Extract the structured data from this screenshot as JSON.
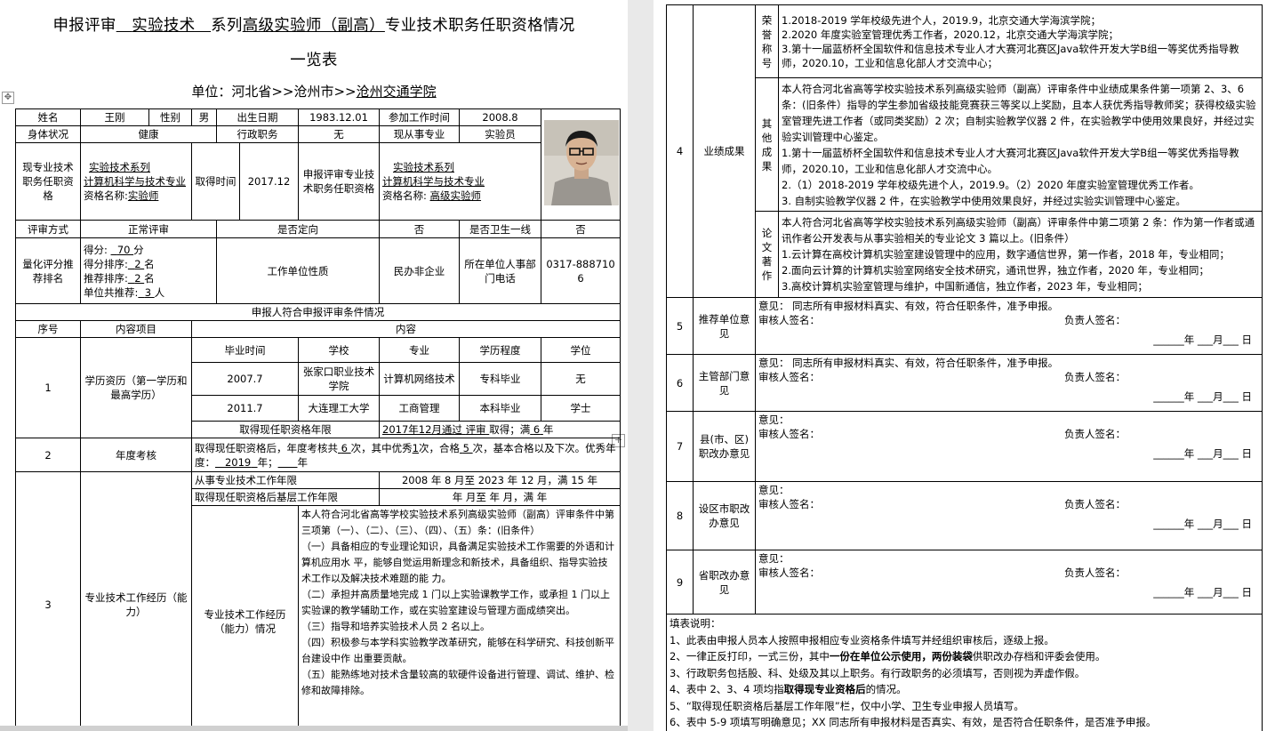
{
  "title": {
    "prefix": "申报评审",
    "series": "实验技术",
    "mid": "系列",
    "qualification": "高级实验师（副高）",
    "suffix": "专业技术职务任职资格情况",
    "line2": "一览表"
  },
  "unit": {
    "prefix": "单位：河北省>>沧州市>>",
    "name": "沧州交通学院"
  },
  "basic": {
    "name_label": "姓名",
    "name": "王刚",
    "gender_label": "性别",
    "gender": "男",
    "dob_label": "出生日期",
    "dob": "1983.12.01",
    "work_start_label": "参加工作时间",
    "work_start": "2008.8",
    "health_label": "身体状况",
    "health": "健康",
    "admin_label": "行政职务",
    "admin": "无",
    "current_major_label": "现从事专业",
    "current_major": "实验员",
    "current_qual_label": "现专业技术职务任职资格",
    "current_qual_series": "实验技术系列",
    "current_qual_major": "计算机科学与技术专业",
    "current_qual_name_label": "资格名称:",
    "current_qual_name": "实验师",
    "obtain_time_label": "取得时间",
    "obtain_time": "2017.12",
    "apply_qual_label": "申报评审专业技术职务任职资格",
    "apply_qual_series": "实验技术系列",
    "apply_qual_major": "计算机科学与技术专业",
    "apply_qual_name_label": "资格名称:",
    "apply_qual_name": "高级实验师",
    "review_method_label": "评审方式",
    "review_method": "正常评审",
    "directed_label": "是否定向",
    "directed": "否",
    "health_front_label": "是否卫生一线",
    "health_front": "否",
    "quant_label": "量化评分推荐排名",
    "score_label": "得分:",
    "score": "70",
    "score_unit": "分",
    "rank_label": "得分排序:",
    "rank": "2",
    "rank_unit": "名",
    "rec_rank_label": "推荐排序:",
    "rec_rank": "2",
    "rec_rank_unit": "名",
    "rec_total_label": "单位共推荐:",
    "rec_total": "3",
    "rec_total_unit": "人",
    "unit_nature_label": "工作单位性质",
    "unit_nature": "民办非企业",
    "unit_phone_label": "所在单位人事部门电话",
    "unit_phone": "0317-8887106"
  },
  "conditions_header": "申报人符合申报评审条件情况",
  "table_headers": {
    "seq": "序号",
    "item": "内容项目",
    "content": "内容"
  },
  "education": {
    "seq": "1",
    "item": "学历资历（第一学历和最高学历）",
    "cols": [
      "毕业时间",
      "学校",
      "专业",
      "学历程度",
      "学位"
    ],
    "rows": [
      [
        "2007.7",
        "张家口职业技术学院",
        "计算机网络技术",
        "专科毕业",
        "无"
      ],
      [
        "2011.7",
        "大连理工大学",
        "工商管理",
        "本科毕业",
        "学士"
      ]
    ],
    "years_label": "取得现任职资格年限",
    "years_value_a": "2017年12月通过",
    "years_value_b": "评审",
    "years_value_c": "取得；满",
    "years_value_d": "6",
    "years_value_e": "年"
  },
  "annual": {
    "seq": "2",
    "item": "年度考核",
    "text_a": "取得现任职资格后，年度考核共",
    "total": "6",
    "text_b": "次，其中优秀",
    "excellent": "1",
    "text_c": "次，合格",
    "pass": "5",
    "text_d": "次，基本合格以及下次。优秀年度：",
    "year": "2019",
    "text_e": "年；",
    "text_f": "年"
  },
  "experience": {
    "seq": "3",
    "item": "专业技术工作经历（能力）",
    "years_label": "从事专业技术工作年限",
    "years_value": "2008 年 8 月至 2023 年 12 月，满 15 年",
    "grassroots_label": "取得现任职资格后基层工作年限",
    "grassroots_value": "年  月至  年  月，满  年",
    "sub_label": "专业技术工作经历（能力）情况",
    "paragraphs": [
      "本人符合河北省高等学校实验技术系列高级实验师（副高）评审条件中第三项第（一）、（二）、（三）、（四）、（五）条：(旧条件）",
      "（一）具备相应的专业理论知识，具备满足实验技术工作需要的外语和计算机应用水 平，能够自觉运用新理念和新技术，具备组织、指导实验技术工作以及解决技术难题的能 力。",
      "（二）承担并高质量地完成 1 门以上实验课教学工作，或承担 1 门以上实验课的教学辅助工作，或在实验室建设与管理方面成绩突出。",
      "（三）指导和培养实验技术人员 2 名以上。",
      "（四）积极参与本学科实验教学改革研究，能够在科学研究、科技创新平台建设中作 出重要贡献。",
      "（五）能熟练地对技术含量较高的软硬件设备进行管理、调试、维护、检修和故障排除。"
    ]
  },
  "achievements": {
    "seq": "4",
    "item": "业绩成果",
    "honors_label": "荣誉称号",
    "honors": [
      "1.2018-2019 学年校级先进个人，2019.9，北京交通大学海滨学院；",
      "2.2020 年度实验室管理优秀工作者，2020.12，北京交通大学海滨学院；",
      "3.第十一届蓝桥杯全国软件和信息技术专业人才大赛河北赛区Java软件开发大学B组一等奖优秀指导教师，2020.10，工业和信息化部人才交流中心；"
    ],
    "other_label": "其他成果",
    "other": [
      "本人符合河北省高等学校实验技术系列高级实验师（副高）评审条件中业绩成果条件第一项第 2、3、6 条：(旧条件）指导的学生参加省级技能竞赛获三等奖以上奖励，且本人获优秀指导教师奖；获得校级实验室管理先进工作者（或同类奖励）2 次；自制实验教学仪器 2 件，在实验教学中使用效果良好，并经过实验实训管理中心鉴定。",
      "1.第十一届蓝桥杯全国软件和信息技术专业人才大赛河北赛区Java软件开发大学B组一等奖优秀指导教师，2020.10，工业和信息化部人才交流中心。",
      "2.（1）2018-2019 学年校级先进个人，2019.9。（2）2020 年度实验室管理优秀工作者。",
      "3. 自制实验教学仪器 2 件，在实验教学中使用效果良好，并经过实验实训管理中心鉴定。"
    ],
    "papers_label": "论文著作",
    "papers": [
      "本人符合河北省高等学校实验技术系列高级实验师（副高）评审条件中第二项第 2 条：作为第一作者或通讯作者公开发表与从事实验相关的专业论文 3 篇以上。(旧条件）",
      "1.云计算在高校计算机实验室建设管理中的应用，数字通信世界，第一作者，2018 年，专业相同；",
      "2.面向云计算的计算机实验室网络安全技术研究，通讯世界，独立作者，2020 年，专业相同；",
      "3.高校计算机实验室管理与维护，中国新通信，独立作者，2023 年，专业相同；"
    ]
  },
  "opinions": [
    {
      "seq": "5",
      "item": "推荐单位意见",
      "text": "意见：          同志所有申报材料真实、有效，符合任职条件，准予申报。",
      "reviewer": "审核人签名：",
      "leader": "负责人签名：",
      "date": "______年  ___月___  日"
    },
    {
      "seq": "6",
      "item": "主管部门意见",
      "text": "意见：          同志所有申报材料真实、有效，符合任职条件，准予申报。",
      "reviewer": "审核人签名：",
      "leader": "负责人签名：",
      "date": "______年  ___月___  日"
    },
    {
      "seq": "7",
      "item": "县(市、区)职改办意见",
      "text": "意见：",
      "reviewer": "审核人签名：",
      "leader": "负责人签名：",
      "date": "______年  ___月___  日"
    },
    {
      "seq": "8",
      "item": "设区市职改办意见",
      "text": "意见：",
      "reviewer": "审核人签名：",
      "leader": "负责人签名：",
      "date": "______年  ___月___  日"
    },
    {
      "seq": "9",
      "item": "省职改办意见",
      "text": "意见：",
      "reviewer": "审核人签名：",
      "leader": "负责人签名：",
      "date": "______年  ___月___  日"
    }
  ],
  "notes": {
    "title": "填表说明：",
    "n1": "1、此表由申报人员本人按照申报相应专业资格条件填写并经组织审核后，逐级上报。",
    "n2_a": "2、一律正反打印，一式三份，其中",
    "n2_b": "一份在单位公示使用，两份装袋",
    "n2_c": "供职改办存档和评委会使用。",
    "n3": "3、行政职务包括股、科、处级及其以上职务。有行政职务的必须填写，否则视为弄虚作假。",
    "n4_a": "4、表中 2、3、4 项均指",
    "n4_b": "取得现专业资格后",
    "n4_c": "的情况。",
    "n5": "5、“取得现任职资格后基层工作年限”栏，仅中小学、卫生专业申报人员填写。",
    "n6": "6、表中 5-9 项填写明确意见；XX 同志所有申报材料是否真实、有效，是否符合任职条件，是否准予申报。"
  }
}
